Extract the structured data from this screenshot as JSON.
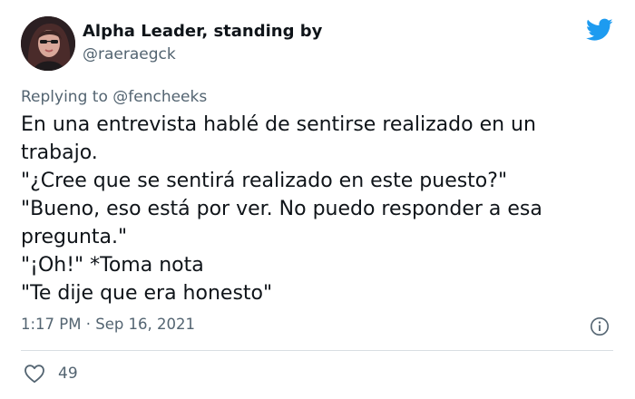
{
  "author": {
    "display_name": "Alpha Leader, standing by",
    "handle": "@raeraegck",
    "avatar_icon": "profile-photo"
  },
  "reply": {
    "prefix": "Replying to ",
    "mention": "@fencheeks"
  },
  "tweet": {
    "lines": [
      "En una entrevista hablé de sentirse realizado en un",
      "trabajo.",
      "\"¿Cree que se sentirá realizado en este puesto?\"",
      "\"Bueno, eso está por ver. No puedo responder a esa",
      "pregunta.\"",
      "\"¡Oh!\" *Toma nota",
      "\"Te dije que era honesto\""
    ],
    "timestamp": "1:17 PM · Sep 16, 2021"
  },
  "stats": {
    "likes": "49"
  },
  "colors": {
    "brand": "#1d9bf0",
    "text": "#0f1419",
    "muted": "#536471"
  },
  "icons": [
    "twitter-bird-icon",
    "info-icon",
    "heart-icon"
  ]
}
